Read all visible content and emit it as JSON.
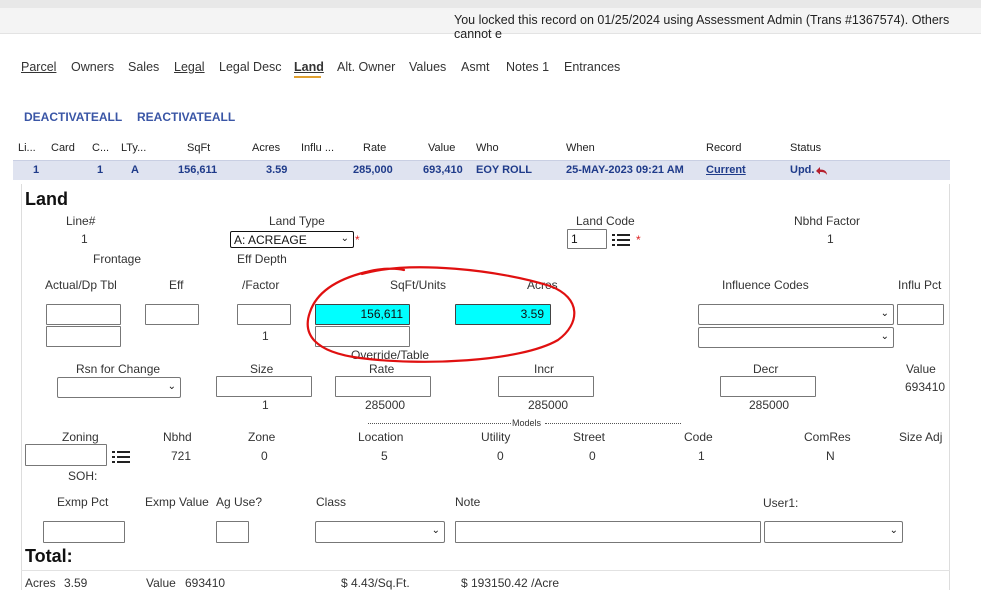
{
  "banner": {
    "message": "You locked this record on 01/25/2024 using Assessment Admin (Trans #1367574). Others cannot e"
  },
  "tabs": [
    {
      "label": "Parcel"
    },
    {
      "label": "Owners"
    },
    {
      "label": "Sales"
    },
    {
      "label": "Legal"
    },
    {
      "label": "Legal Desc"
    },
    {
      "label": "Land"
    },
    {
      "label": "Alt. Owner"
    },
    {
      "label": "Values"
    },
    {
      "label": "Asmt"
    },
    {
      "label": "Notes 1"
    },
    {
      "label": "Entrances"
    }
  ],
  "actions": {
    "deactivate": "DEACTIVATEALL",
    "reactivate": "REACTIVATEALL"
  },
  "grid": {
    "headers": [
      "Li...",
      "Card",
      "C...",
      "LTy...",
      "SqFt",
      "Acres",
      "Influ ...",
      "Rate",
      "Value",
      "Who",
      "When",
      "Record",
      "Status"
    ],
    "row": {
      "line": "1",
      "card": "1",
      "type": "A",
      "sqft": "156,611",
      "acres": "3.59",
      "rate": "285,000",
      "value": "693,410",
      "who": "EOY ROLL",
      "when": "25-MAY-2023 09:21 AM",
      "record": "Current",
      "status": "Upd."
    }
  },
  "land": {
    "title": "Land",
    "line_label": "Line#",
    "line_value": "1",
    "land_type_label": "Land Type",
    "land_type_value": "A: ACREAGE",
    "land_code_label": "Land Code",
    "land_code_value": "1",
    "nbhd_factor_label": "Nbhd Factor",
    "nbhd_factor_value": "1",
    "frontage_label": "Frontage",
    "eff_depth_label": "Eff Depth",
    "actual_label": "Actual/Dp Tbl",
    "eff_label": "Eff",
    "factor_label": "/Factor",
    "factor_value": "1",
    "sqft_units_label": "SqFt/Units",
    "sqft_units_value": "156,611",
    "acres_label": "Acres",
    "acres_value": "3.59",
    "override_label": "Override/Table",
    "influence_codes_label": "Influence Codes",
    "influ_pct_label": "Influ Pct",
    "rsn_label": "Rsn for Change",
    "size_label": "Size",
    "size_value": "1",
    "rate_label": "Rate",
    "rate_value": "285000",
    "incr_label": "Incr",
    "incr_value": "285000",
    "decr_label": "Decr",
    "decr_value": "285000",
    "value_label": "Value",
    "value_value": "693410",
    "models_label": "Models",
    "zoning_label": "Zoning",
    "soh_label": "SOH:",
    "nbhd_label": "Nbhd",
    "nbhd_value": "721",
    "zone_label": "Zone",
    "zone_value": "0",
    "location_label": "Location",
    "location_value": "5",
    "utility_label": "Utility",
    "utility_value": "0",
    "street_label": "Street",
    "street_value": "0",
    "code_label": "Code",
    "code_value": "1",
    "comres_label": "ComRes",
    "comres_value": "N",
    "size_adj_label": "Size Adj",
    "exmp_pct_label": "Exmp Pct",
    "exmp_value_label": "Exmp Value",
    "ag_use_label": "Ag Use?",
    "class_label": "Class",
    "note_label": "Note",
    "user1_label": "User1:"
  },
  "total": {
    "title": "Total:",
    "acres_label": "Acres",
    "acres_value": "3.59",
    "value_label": "Value",
    "value_value": "693410",
    "per_sqft": "$  4.43/Sq.Ft.",
    "per_acre": "$ 193150.42 /Acre"
  },
  "colors": {
    "highlight": "#00ffff",
    "annotation": "#e01010",
    "link": "#3a56a6",
    "tab_active": "#e0a030"
  }
}
